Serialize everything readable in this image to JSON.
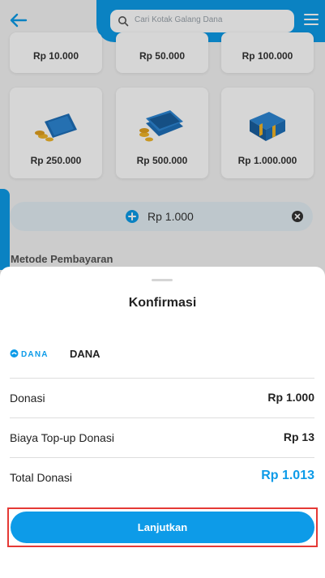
{
  "header": {
    "search_placeholder": "Cari Kotak Galang Dana"
  },
  "amount_cards": [
    {
      "label": "Rp 10.000"
    },
    {
      "label": "Rp 50.000"
    },
    {
      "label": "Rp 100.000"
    },
    {
      "label": "Rp 250.000"
    },
    {
      "label": "Rp 500.000"
    },
    {
      "label": "Rp 1.000.000"
    }
  ],
  "custom_amount": {
    "value": "Rp 1.000"
  },
  "payment_section": {
    "title": "Metode Pembayaran"
  },
  "sheet": {
    "title": "Konfirmasi",
    "payment_method": {
      "logo_text": "DANA",
      "name": "DANA"
    },
    "rows": [
      {
        "label": "Donasi",
        "value": "Rp 1.000"
      },
      {
        "label": "Biaya Top-up Donasi",
        "value": "Rp 13"
      },
      {
        "label": "Total Donasi",
        "value": "Rp 1.013"
      }
    ],
    "cta_label": "Lanjutkan"
  },
  "colors": {
    "accent": "#0d9be8",
    "highlight_border": "#e53935"
  }
}
